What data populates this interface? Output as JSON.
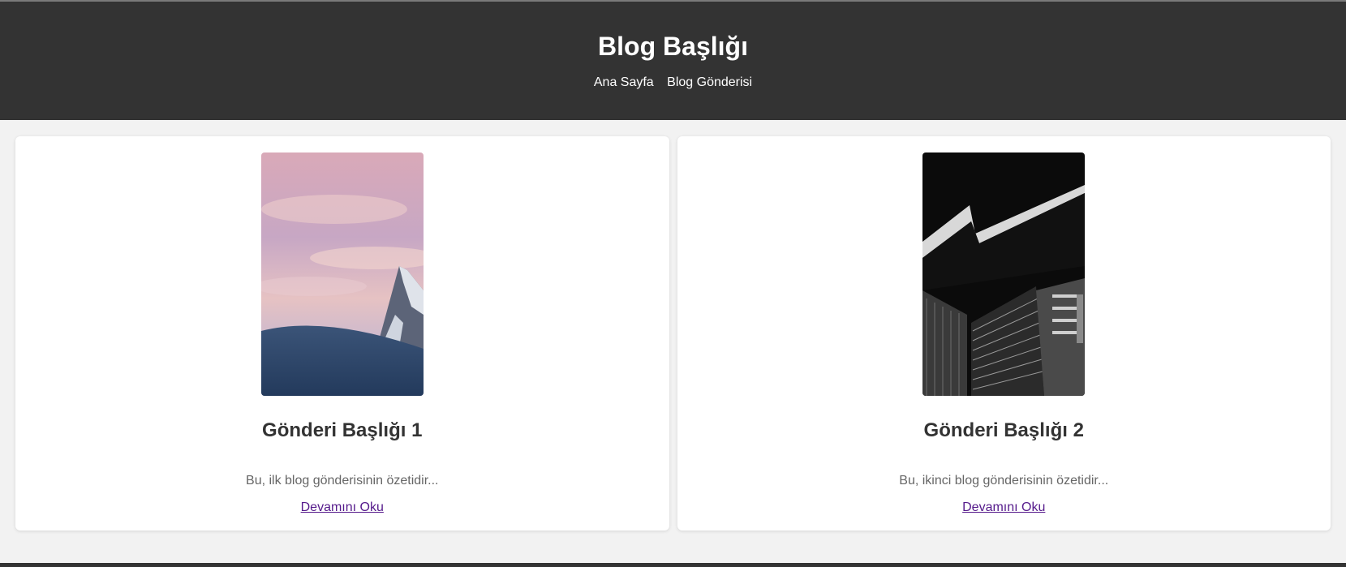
{
  "header": {
    "title": "Blog Başlığı",
    "nav": [
      {
        "label": "Ana Sayfa"
      },
      {
        "label": "Blog Gönderisi"
      }
    ]
  },
  "posts": [
    {
      "title": "Gönderi Başlığı 1",
      "excerpt": "Bu, ilk blog gönderisinin özetidir...",
      "link_label": "Devamını Oku",
      "image": "mountain-sunset-photo"
    },
    {
      "title": "Gönderi Başlığı 2",
      "excerpt": "Bu, ikinci blog gönderisinin özetidir...",
      "link_label": "Devamını Oku",
      "image": "black-white-building-photo"
    }
  ],
  "colors": {
    "header_bg": "#333333",
    "page_bg": "#f2f2f2",
    "link_visited": "#551a8b"
  }
}
